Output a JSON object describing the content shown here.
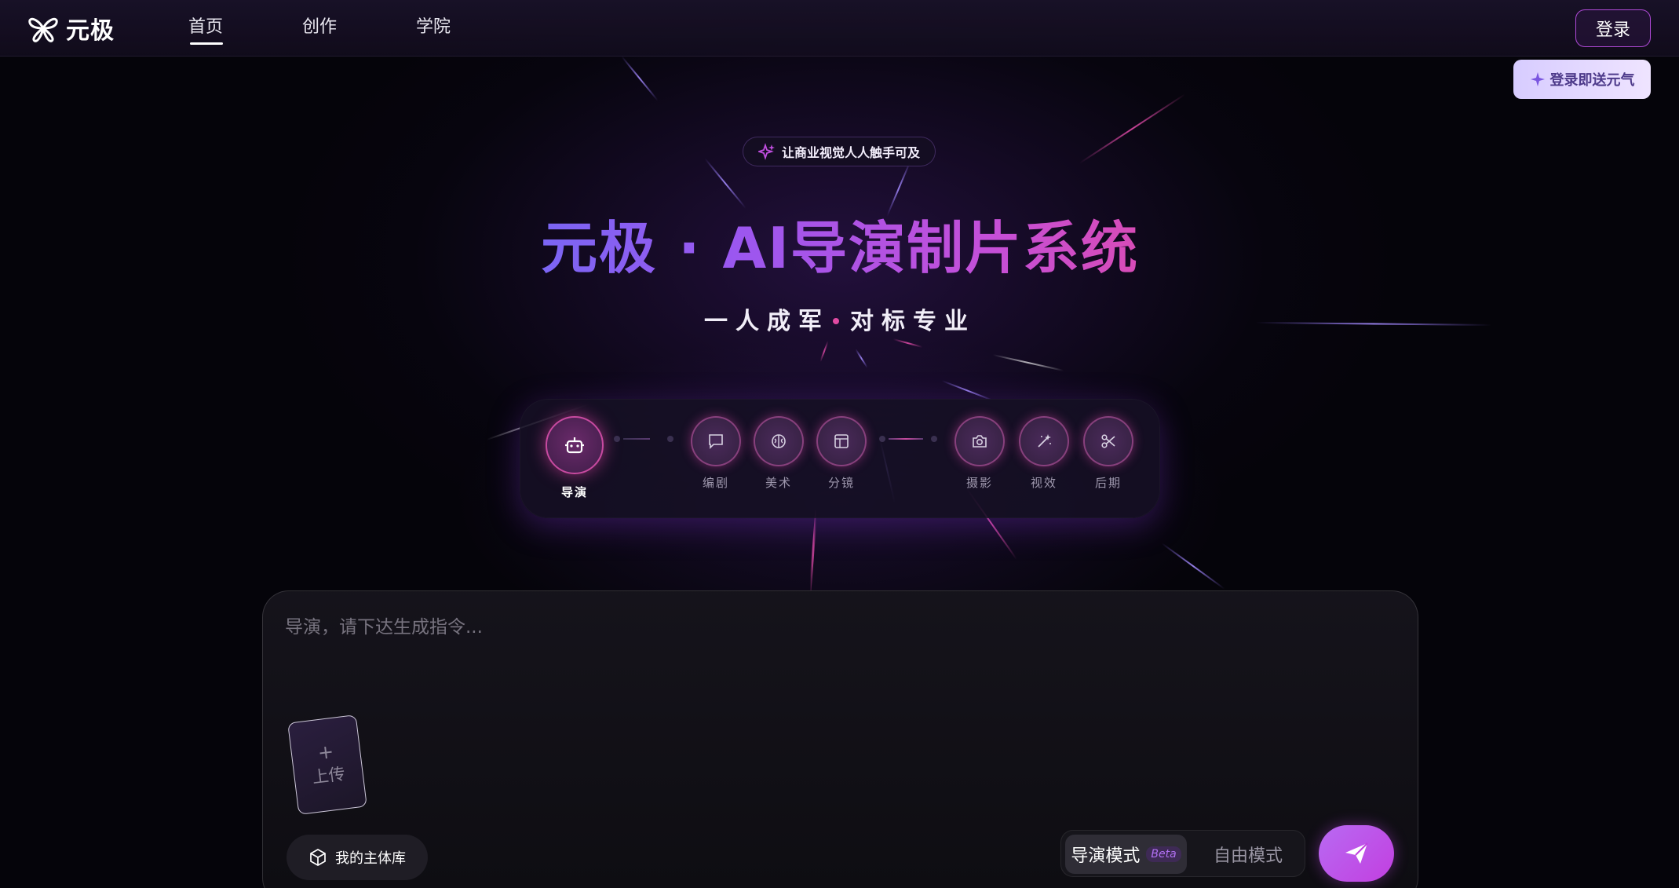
{
  "header": {
    "brand": "元极",
    "nav": [
      "首页",
      "创作",
      "学院"
    ],
    "active_nav": "首页",
    "login_label": "登录",
    "promo_label": "登录即送元气"
  },
  "hero": {
    "tagline": "让商业视觉人人触手可及",
    "title": "元极 · AI导演制片系统",
    "subtitle_left": "一人成军",
    "subtitle_right": "对标专业"
  },
  "pipeline": {
    "main_step": "导演",
    "groups": [
      [
        "编剧",
        "美术",
        "分镜"
      ],
      [
        "摄影",
        "视效",
        "后期"
      ]
    ]
  },
  "composer": {
    "placeholder": "导演，请下达生成指令...",
    "upload_plus": "+",
    "upload_label": "上传",
    "library_label": "我的主体库",
    "mode_active": "导演模式",
    "mode_badge": "Beta",
    "mode_inactive": "自由模式"
  },
  "colors": {
    "accent_pink": "#e04aa8",
    "accent_purple": "#9a57f0",
    "send_button": "#c23fe0"
  }
}
